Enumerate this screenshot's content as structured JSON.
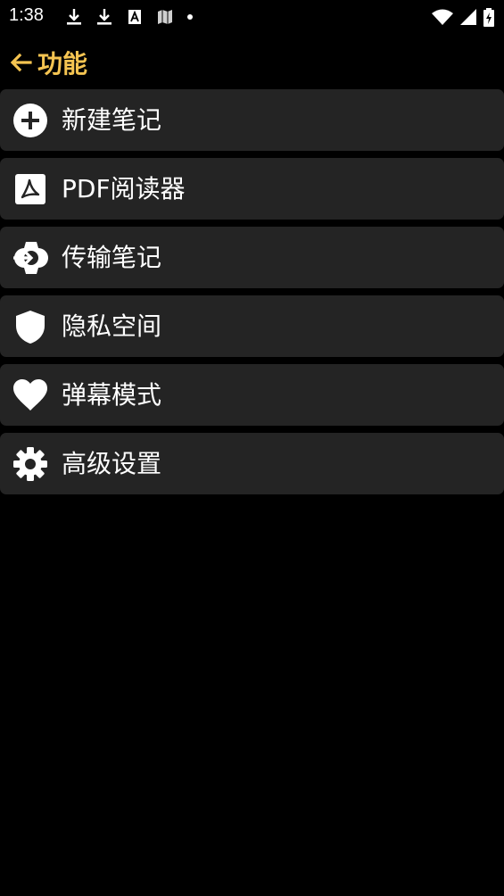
{
  "status_bar": {
    "time": "1:38",
    "left_icons": [
      "download-icon",
      "download-icon",
      "a-box-icon",
      "map-icon",
      "dot-icon"
    ],
    "right_icons": [
      "wifi-icon",
      "cellular-signal-icon",
      "battery-charging-icon"
    ]
  },
  "header": {
    "back_icon": "arrow-left-icon",
    "title": "功能"
  },
  "menu": [
    {
      "icon": "plus-circle-icon",
      "label": "新建笔记"
    },
    {
      "icon": "pdf-icon",
      "label": "PDF阅读器"
    },
    {
      "icon": "watch-transfer-icon",
      "label": "传输笔记"
    },
    {
      "icon": "shield-icon",
      "label": "隐私空间"
    },
    {
      "icon": "heart-icon",
      "label": "弹幕模式"
    },
    {
      "icon": "gear-icon",
      "label": "高级设置"
    }
  ],
  "colors": {
    "background": "#000000",
    "item_background": "#242424",
    "accent": "#f5c451",
    "text": "#ffffff"
  }
}
